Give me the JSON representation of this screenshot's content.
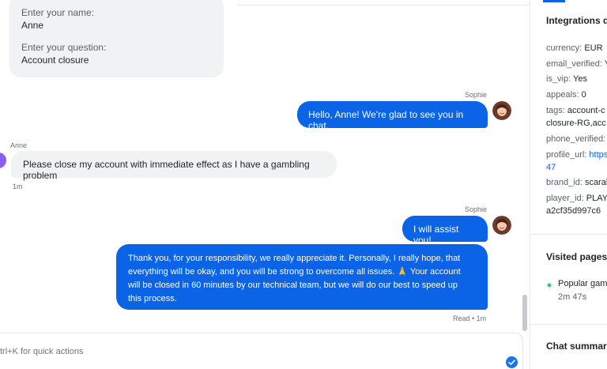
{
  "intake_form": {
    "name_label": "Enter your name:",
    "name_value": "Anne",
    "question_label": "Enter your question:",
    "question_value": "Account closure"
  },
  "messages": [
    {
      "sender": "Sophie",
      "text": "Hello, Anne! We're glad to see you in chat.",
      "direction": "outgoing"
    },
    {
      "sender": "Anne",
      "text": "Please close my account with immediate effect as I have a gambling problem",
      "direction": "incoming",
      "time": "1m"
    },
    {
      "sender": "Sophie",
      "text": "I will assist you!",
      "direction": "outgoing"
    },
    {
      "sender": "Sophie",
      "direction": "outgoing",
      "lines": [
        "Thank you, for your responsibility, we really appreciate it. Personally, I really hope, that",
        "everything will be okay, and you will be strong to overcome all issues. 🙏 Your account",
        "will be closed in 60 minutes by our technical team, but we will do our best to speed up",
        "this process."
      ],
      "status": "Read • 1m"
    }
  ],
  "composer": {
    "placeholder": "trl+K for quick actions"
  },
  "sidebar": {
    "integrations_heading": "Integrations d",
    "fields": [
      {
        "key": "currency:",
        "value": "EUR"
      },
      {
        "key": "email_verified:",
        "value": "Y"
      },
      {
        "key": "is_vip:",
        "value": "Yes"
      },
      {
        "key": "appeals:",
        "value": "0"
      },
      {
        "key": "tags:",
        "value": "account-c"
      },
      {
        "key": "",
        "value": "closure-RG,acc"
      },
      {
        "key": "phone_verified:",
        "value": ""
      },
      {
        "key": "profile_url:",
        "value": "https"
      },
      {
        "key": "",
        "value": "47"
      },
      {
        "key": "brand_id:",
        "value": "scaral"
      },
      {
        "key": "player_id:",
        "value": "PLAYE"
      },
      {
        "key": "",
        "value": "a2cf35d997c6"
      }
    ],
    "visited_heading": "Visited pages",
    "visited_item": "Popular gam",
    "visited_time": "2m 47s",
    "summary_heading": "Chat summar"
  },
  "colors": {
    "accent": "#0b63e5",
    "bubble_incoming": "#f1f2f4",
    "online": "#2fb86a"
  }
}
